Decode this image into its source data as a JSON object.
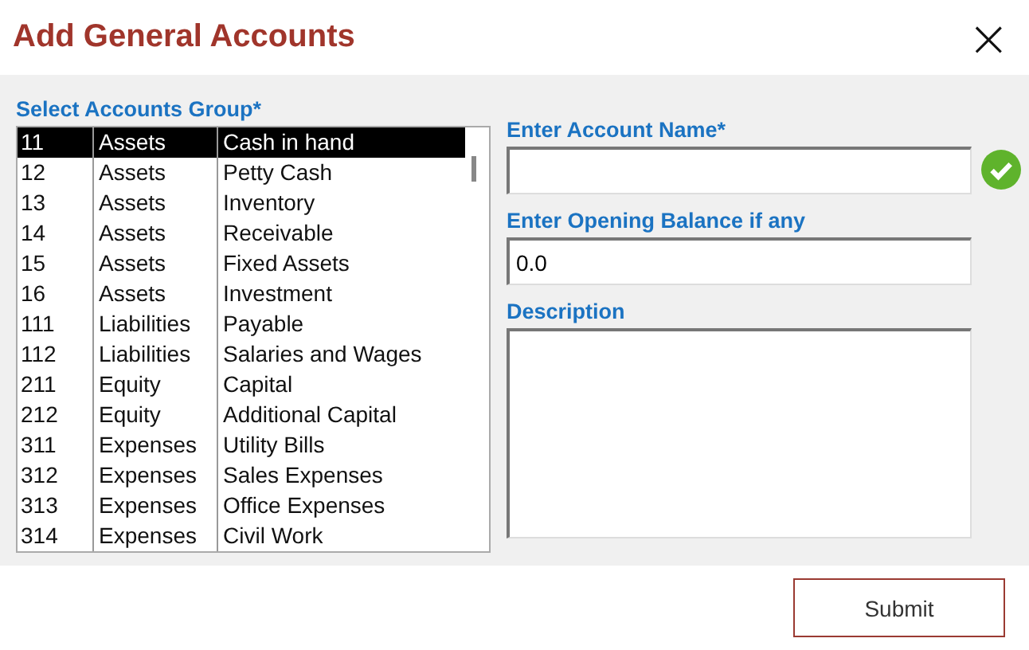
{
  "window": {
    "title": "Add General Accounts",
    "close": "×"
  },
  "group_list": {
    "label": "Select Accounts Group*",
    "rows": [
      {
        "code": "11",
        "type": "Assets",
        "name": "Cash in hand",
        "selected": true
      },
      {
        "code": "12",
        "type": "Assets",
        "name": "Petty Cash",
        "selected": false
      },
      {
        "code": "13",
        "type": "Assets",
        "name": "Inventory",
        "selected": false
      },
      {
        "code": "14",
        "type": "Assets",
        "name": "Receivable",
        "selected": false
      },
      {
        "code": "15",
        "type": "Assets",
        "name": "Fixed Assets",
        "selected": false
      },
      {
        "code": "16",
        "type": "Assets",
        "name": "Investment",
        "selected": false
      },
      {
        "code": "111",
        "type": "Liabilities",
        "name": "Payable",
        "selected": false
      },
      {
        "code": "112",
        "type": "Liabilities",
        "name": "Salaries and Wages",
        "selected": false
      },
      {
        "code": "211",
        "type": "Equity",
        "name": "Capital",
        "selected": false
      },
      {
        "code": "212",
        "type": "Equity",
        "name": "Additional Capital",
        "selected": false
      },
      {
        "code": "311",
        "type": "Expenses",
        "name": "Utility Bills",
        "selected": false
      },
      {
        "code": "312",
        "type": "Expenses",
        "name": "Sales Expenses",
        "selected": false
      },
      {
        "code": "313",
        "type": "Expenses",
        "name": "Office Expenses",
        "selected": false
      },
      {
        "code": "314",
        "type": "Expenses",
        "name": "Civil Work",
        "selected": false
      }
    ]
  },
  "account_name": {
    "label": "Enter Account Name*",
    "valid": true
  },
  "opening_balance": {
    "label": "Enter Opening Balance if any",
    "value": "0.0"
  },
  "description": {
    "label": "Description"
  },
  "buttons": [
    "Submit"
  ]
}
